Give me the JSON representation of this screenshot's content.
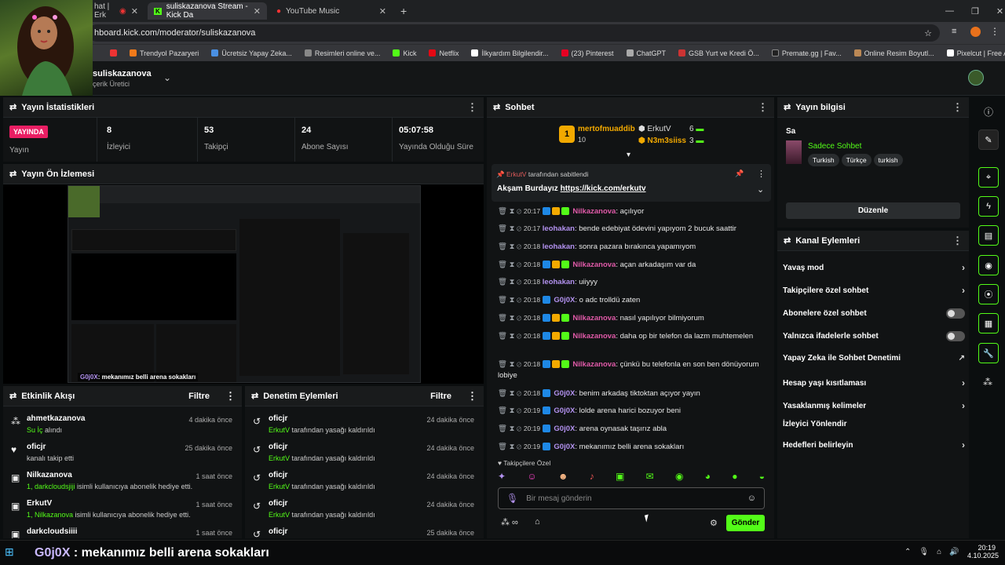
{
  "browser": {
    "tabs": [
      {
        "label": "hat | Erk"
      },
      {
        "label": "suliskazanova Stream - Kick Da"
      },
      {
        "label": "YouTube Music"
      }
    ],
    "url": "hboard.kick.com/moderator/suliskazanova",
    "bookmarks": [
      "Trendyol Pazaryeri",
      "Ücretsiz Yapay Zeka...",
      "Resimleri online ve...",
      "Kick",
      "Netflix",
      "İlkyardım Bilgilendir...",
      "(23) Pinterest",
      "ChatGPT",
      "GSB Yurt ve Kredi Ö...",
      "Premate.gg | Fav...",
      "Online Resim Boyutl...",
      "Pixelcut | Free AI Ph..."
    ]
  },
  "header": {
    "channel": "suliskazanova",
    "role": "çerik Üretici"
  },
  "stats": {
    "title": "Yayın İstatistikleri",
    "live_badge": "YAYINDA",
    "live_label": "Yayın",
    "items": [
      {
        "value": "8",
        "label": "İzleyici"
      },
      {
        "value": "53",
        "label": "Takipçi"
      },
      {
        "value": "24",
        "label": "Abone Sayısı"
      },
      {
        "value": "05:07:58",
        "label": "Yayında Olduğu Süre"
      }
    ]
  },
  "preview": {
    "title": "Yayın Ön İzlemesi"
  },
  "activity": {
    "title": "Etkinlik Akışı",
    "filter": "Filtre",
    "items": [
      {
        "name": "ahmetkazanova",
        "time": "4 dakika önce",
        "detail_hl": "Su İç",
        "detail": " alındı"
      },
      {
        "name": "oficjr",
        "time": "25 dakika önce",
        "detail_hl": "",
        "detail": "kanalı takip etti"
      },
      {
        "name": "Nilkazanova",
        "time": "1 saat önce",
        "detail_hl": "1, darkcloudsjiji",
        "detail": " isimli kullanıcıya abonelik hediye etti."
      },
      {
        "name": "ErkutV",
        "time": "1 saat önce",
        "detail_hl": "1, Nilkazanova",
        "detail": " isimli kullanıcıya abonelik hediye etti."
      },
      {
        "name": "darkcloudsiiii",
        "time": "1 saat önce",
        "detail_hl": "",
        "detail": ""
      }
    ]
  },
  "moderation": {
    "title": "Denetim Eylemleri",
    "filter": "Filtre",
    "items": [
      {
        "name": "oficjr",
        "time": "24 dakika önce",
        "by": "ErkutV",
        "text": " tarafından yasağı kaldırıldı"
      },
      {
        "name": "oficjr",
        "time": "24 dakika önce",
        "by": "ErkutV",
        "text": " tarafından yasağı kaldırıldı"
      },
      {
        "name": "oficjr",
        "time": "24 dakika önce",
        "by": "ErkutV",
        "text": " tarafından yasağı kaldırıldı"
      },
      {
        "name": "oficjr",
        "time": "24 dakika önce",
        "by": "ErkutV",
        "text": " tarafından yasağı kaldırıldı"
      },
      {
        "name": "oficjr",
        "time": "25 dakika önce",
        "by": "",
        "text": ""
      }
    ]
  },
  "chat": {
    "title": "Sohbet",
    "leaders": {
      "first_name": "mertofmuaddib",
      "first_rank": "1",
      "first_count": "10",
      "second_name": "ErkutV",
      "second_count": "6",
      "third_name": "N3m3siiss",
      "third_count": "3"
    },
    "pinned": {
      "by": "ErkutV",
      "by_text": "tarafından sabitlendi",
      "message": "Akşam Burdayız",
      "link": "https://kick.com/erkutv"
    },
    "messages": [
      {
        "time": "20:17",
        "user": "Nilkazanova",
        "cls": "u-pink",
        "text": "açılıyor"
      },
      {
        "time": "20:17",
        "user": "leohakan",
        "cls": "u-purple",
        "text": "bende edebiyat ödevini yapıyom 2 bucuk saattir"
      },
      {
        "time": "20:18",
        "user": "leohakan",
        "cls": "u-purple",
        "text": "sonra pazara bırakınca yapamıyom"
      },
      {
        "time": "20:18",
        "user": "Nilkazanova",
        "cls": "u-pink",
        "text": "açan arkadaşım var da"
      },
      {
        "time": "20:18",
        "user": "leohakan",
        "cls": "u-purple",
        "text": "uiiyyy"
      },
      {
        "time": "20:18",
        "user": "G0j0X",
        "cls": "u-purple",
        "text": "o adc trolldü zaten"
      },
      {
        "time": "20:18",
        "user": "Nilkazanova",
        "cls": "u-pink",
        "text": "nasıl yapılıyor bilmiyorum"
      },
      {
        "time": "20:18",
        "user": "Nilkazanova",
        "cls": "u-pink",
        "text": "daha op bir telefon da lazm muhtemelen"
      },
      {
        "time": "20:18",
        "user": "Nilkazanova",
        "cls": "u-pink",
        "text": "çünkü bu telefonla en son ben dönüyorum lobiye"
      },
      {
        "time": "20:18",
        "user": "G0j0X",
        "cls": "u-purple",
        "text": "benim arkadaş tiktoktan açıyor yayın"
      },
      {
        "time": "20:19",
        "user": "G0j0X",
        "cls": "u-purple",
        "text": "lolde arena harici bozuyor beni"
      },
      {
        "time": "20:19",
        "user": "G0j0X",
        "cls": "u-purple",
        "text": "arena oynasak taşırız abla"
      },
      {
        "time": "20:19",
        "user": "G0j0X",
        "cls": "u-purple",
        "text": "mekanımız belli arena sokakları"
      }
    ],
    "followers_only": "Takipçilere Özel",
    "input_placeholder": "Bir mesaj gönderin",
    "send": "Gönder"
  },
  "stream_info": {
    "title": "Yayın bilgisi",
    "stream_title": "Sa",
    "category": "Sadece Sohbet",
    "tags": [
      "Turkish",
      "Türkçe",
      "turkish"
    ],
    "edit": "Düzenle"
  },
  "channel_actions": {
    "title": "Kanal Eylemleri",
    "items": [
      {
        "label": "Yavaş mod",
        "kind": "chev"
      },
      {
        "label": "Takipçilere özel sohbet",
        "kind": "chev"
      },
      {
        "label": "Abonelere özel sohbet",
        "kind": "toggle"
      },
      {
        "label": "Yalnızca ifadelerle sohbet",
        "kind": "toggle"
      },
      {
        "label": "Yapay Zeka ile Sohbet Denetimi",
        "kind": "ext"
      },
      {
        "label": "Hesap yaşı kısıtlaması",
        "kind": "chev"
      },
      {
        "label": "Yasaklanmış kelimeler",
        "kind": "chev"
      },
      {
        "label": "İzleyici Yönlendir",
        "kind": "none"
      },
      {
        "label": "Hedefleri belirleyin",
        "kind": "chev"
      }
    ]
  },
  "overlay_caption": {
    "user": "G0j0X",
    "text": ": mekanımız belli arena sokakları"
  },
  "taskbar": {
    "time": "20:19",
    "date": "4.10.2025"
  },
  "colors": {
    "accent": "#53fc18",
    "live": "#e91e63"
  }
}
